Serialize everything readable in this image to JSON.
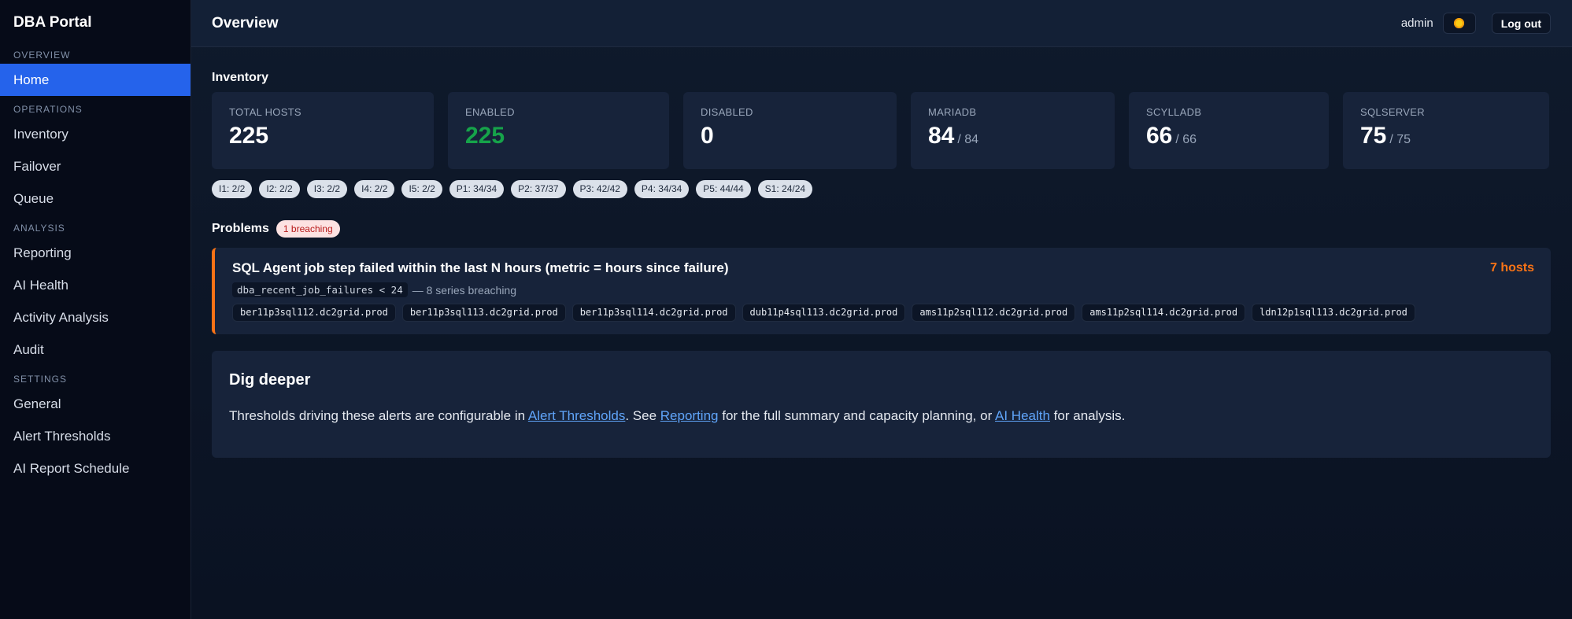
{
  "brand": "DBA Portal",
  "sidebar": {
    "sections": [
      {
        "label": "OVERVIEW",
        "items": [
          "Home"
        ]
      },
      {
        "label": "OPERATIONS",
        "items": [
          "Inventory",
          "Failover",
          "Queue"
        ]
      },
      {
        "label": "ANALYSIS",
        "items": [
          "Reporting",
          "AI Health",
          "Activity Analysis",
          "Audit"
        ]
      },
      {
        "label": "SETTINGS",
        "items": [
          "General",
          "Alert Thresholds",
          "AI Report Schedule"
        ]
      }
    ],
    "active": "Home"
  },
  "header": {
    "title": "Overview",
    "user": "admin",
    "theme_icon": "sun-icon",
    "logout_label": "Log out"
  },
  "inventory": {
    "title": "Inventory",
    "stats": [
      {
        "label": "TOTAL HOSTS",
        "value": "225",
        "sub": ""
      },
      {
        "label": "ENABLED",
        "value": "225",
        "sub": "",
        "color": "#16a34a"
      },
      {
        "label": "DISABLED",
        "value": "0",
        "sub": ""
      },
      {
        "label": "MARIADB",
        "value": "84",
        "sub": "/ 84"
      },
      {
        "label": "SCYLLADB",
        "value": "66",
        "sub": "/ 66"
      },
      {
        "label": "SQLSERVER",
        "value": "75",
        "sub": "/ 75"
      }
    ],
    "pills": [
      "I1: 2/2",
      "I2: 2/2",
      "I3: 2/2",
      "I4: 2/2",
      "I5: 2/2",
      "P1: 34/34",
      "P2: 37/37",
      "P3: 42/42",
      "P4: 34/34",
      "P5: 44/44",
      "S1: 24/24"
    ]
  },
  "problems": {
    "title": "Problems",
    "badge": "1 breaching",
    "alert": {
      "title": "SQL Agent job step failed within the last N hours (metric = hours since failure)",
      "count": "7 hosts",
      "expr": "dba_recent_job_failures < 24",
      "series_text": "— 8 series breaching",
      "hosts": [
        "ber11p3sql112.dc2grid.prod",
        "ber11p3sql113.dc2grid.prod",
        "ber11p3sql114.dc2grid.prod",
        "dub11p4sql113.dc2grid.prod",
        "ams11p2sql112.dc2grid.prod",
        "ams11p2sql114.dc2grid.prod",
        "ldn12p1sql113.dc2grid.prod"
      ],
      "accent": "#f97316"
    }
  },
  "dig": {
    "title": "Dig deeper",
    "t1": "Thresholds driving these alerts are configurable in ",
    "l1": "Alert Thresholds",
    "t2": ". See ",
    "l2": "Reporting",
    "t3": " for the full summary and capacity planning, or ",
    "l3": "AI Health",
    "t4": " for analysis."
  }
}
